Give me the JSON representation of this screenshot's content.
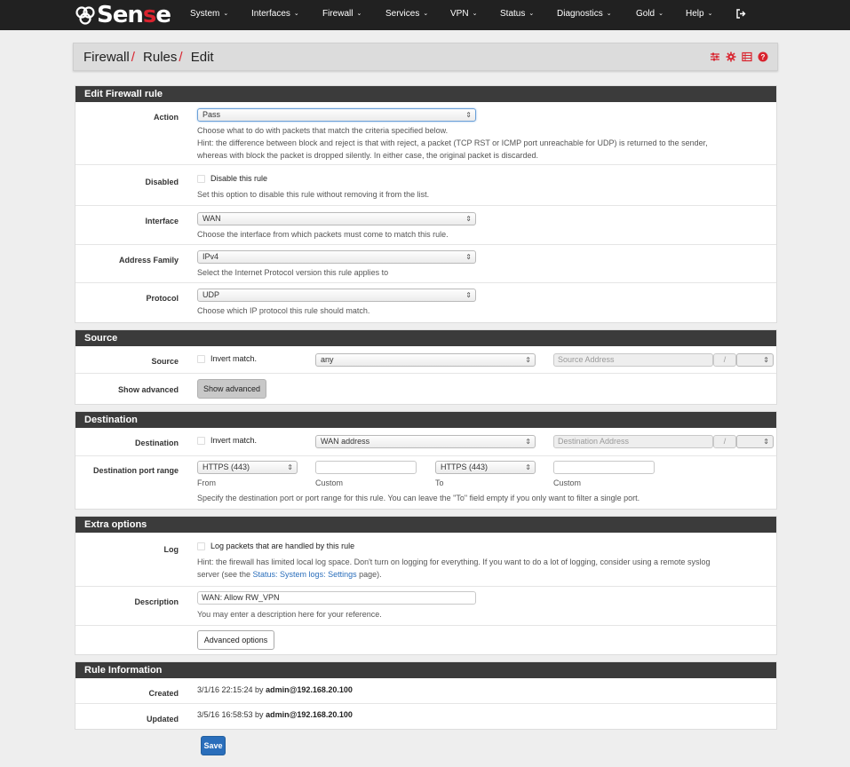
{
  "brand": {
    "logo_text_1": "Sen",
    "logo_text_2": "s",
    "logo_text_3": "e"
  },
  "nav": {
    "items": [
      "System",
      "Interfaces",
      "Firewall",
      "Services",
      "VPN",
      "Status",
      "Diagnostics",
      "Gold",
      "Help"
    ]
  },
  "breadcrumb": {
    "part1": "Firewall",
    "part2": "Rules",
    "part3": "Edit"
  },
  "edit_rule": {
    "title": "Edit Firewall rule",
    "action": {
      "label": "Action",
      "value": "Pass",
      "help1": "Choose what to do with packets that match the criteria specified below.",
      "help2": "Hint: the difference between block and reject is that with reject, a packet (TCP RST or ICMP port unreachable for UDP) is returned to the sender,",
      "help3": "whereas with block the packet is dropped silently. In either case, the original packet is discarded."
    },
    "disabled": {
      "label": "Disabled",
      "checkbox": "Disable this rule",
      "help": "Set this option to disable this rule without removing it from the list."
    },
    "interface": {
      "label": "Interface",
      "value": "WAN",
      "help": "Choose the interface from which packets must come to match this rule."
    },
    "family": {
      "label": "Address Family",
      "value": "IPv4",
      "help": "Select the Internet Protocol version this rule applies to"
    },
    "protocol": {
      "label": "Protocol",
      "value": "UDP",
      "help": "Choose which IP protocol this rule should match."
    }
  },
  "source": {
    "title": "Source",
    "label": "Source",
    "invert": "Invert match.",
    "type": "any",
    "address_placeholder": "Source Address",
    "slash": "/",
    "adv_label": "Show advanced",
    "adv_button": "Show advanced"
  },
  "destination": {
    "title": "Destination",
    "label": "Destination",
    "invert": "Invert match.",
    "type": "WAN address",
    "address_placeholder": "Destination Address",
    "slash": "/",
    "port_label": "Destination port range",
    "from_value": "HTTPS (443)",
    "to_value": "HTTPS (443)",
    "from_caption": "From",
    "custom_caption_1": "Custom",
    "to_caption": "To",
    "custom_caption_2": "Custom",
    "port_help": "Specify the destination port or port range for this rule. You can leave the \"To\" field empty if you only want to filter a single port."
  },
  "extra": {
    "title": "Extra options",
    "log_label": "Log",
    "log_checkbox": "Log packets that are handled by this rule",
    "log_help1": "Hint: the firewall has limited local log space. Don't turn on logging for everything. If you want to do a lot of logging, consider using a remote syslog",
    "log_help2a": "server (see the ",
    "log_help_link": "Status: System logs: Settings",
    "log_help2b": " page).",
    "desc_label": "Description",
    "desc_value": "WAN: Allow RW_VPN",
    "desc_help": "You may enter a description here for your reference.",
    "advanced_button": "Advanced options"
  },
  "info": {
    "title": "Rule Information",
    "created_label": "Created",
    "created_time": "3/1/16 22:15:24 by ",
    "created_by": "admin@192.168.20.100",
    "updated_label": "Updated",
    "updated_time": "3/5/16 16:58:53 by ",
    "updated_by": "admin@192.168.20.100"
  },
  "save_button": "Save",
  "colors": {
    "accent": "#d9232e",
    "header": "#3b3b3b",
    "primary": "#2a6ebb"
  },
  "icons": [
    "sliders-icon",
    "gear-icon",
    "list-icon",
    "help-icon",
    "logout-icon"
  ]
}
